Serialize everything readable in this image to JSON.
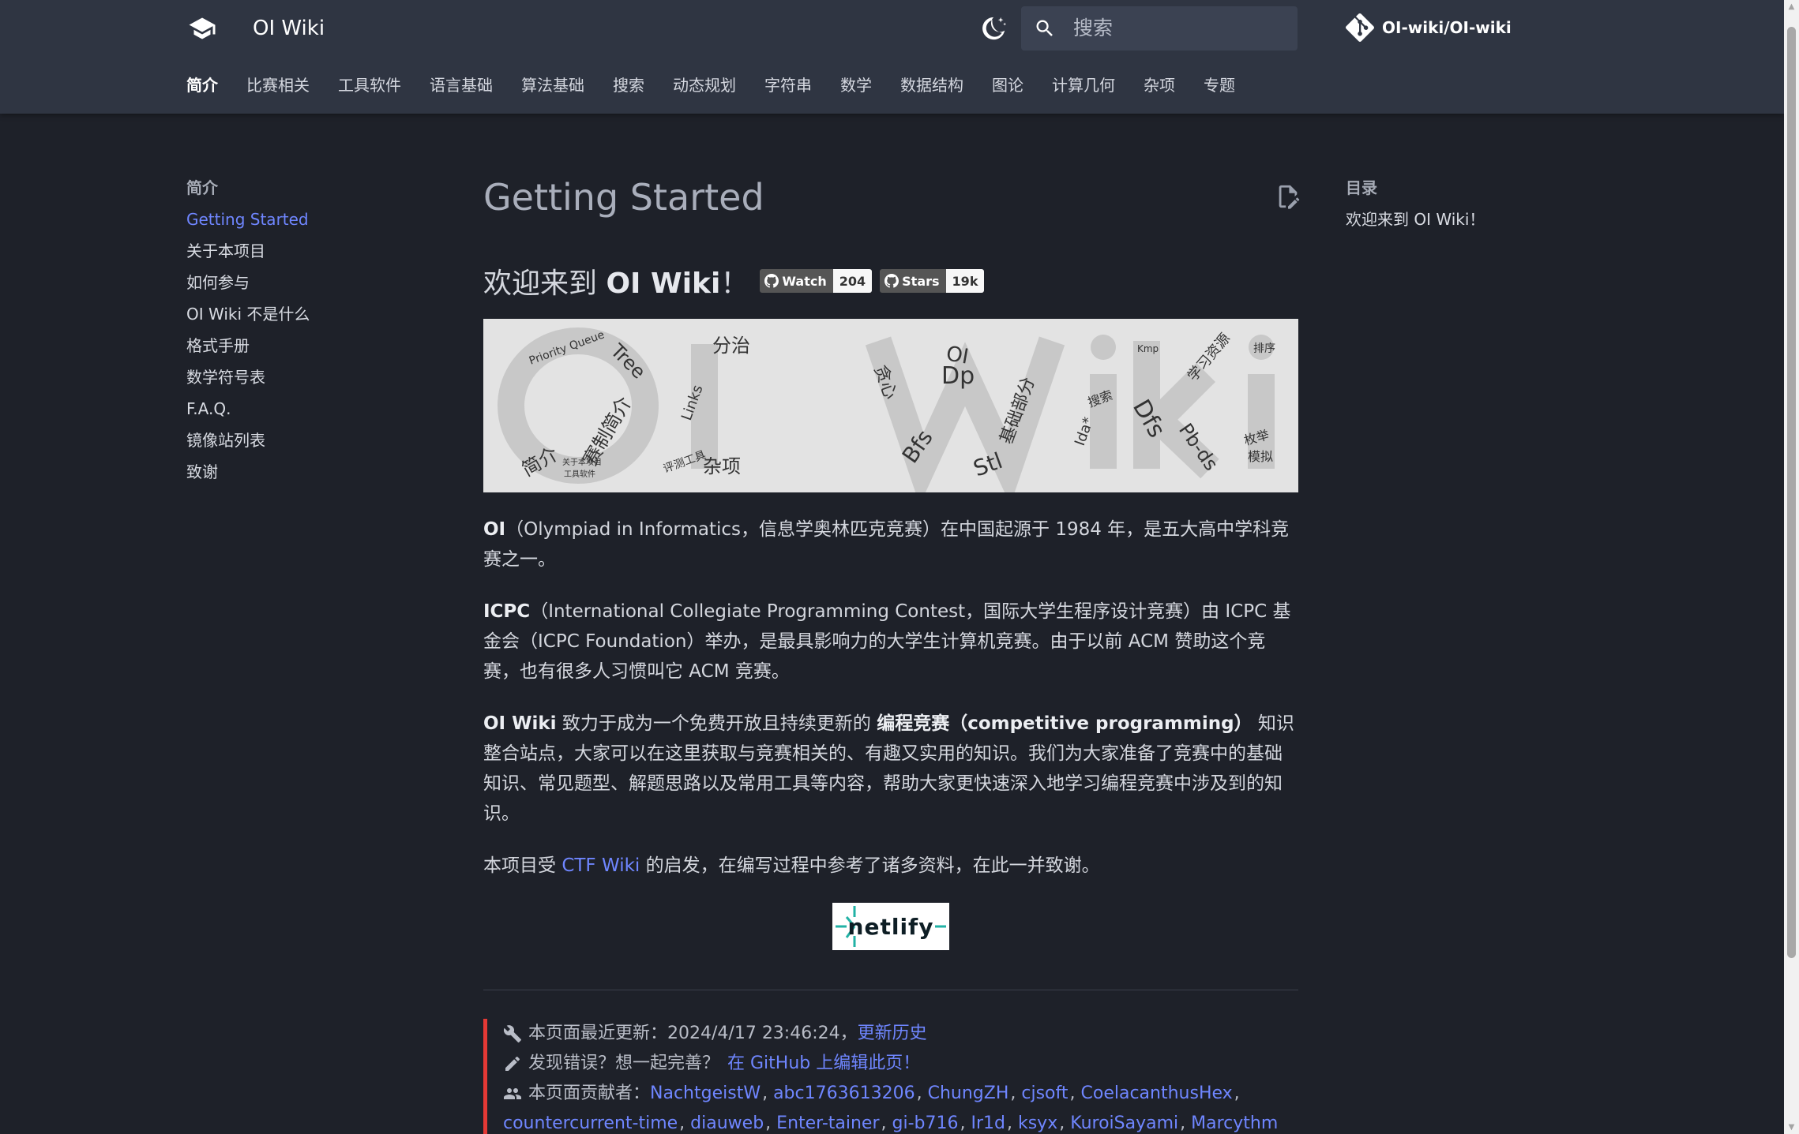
{
  "header": {
    "site_title": "OI Wiki",
    "search_placeholder": "搜索",
    "repo_name": "OI-wiki/OI-wiki",
    "tabs": [
      "简介",
      "比赛相关",
      "工具软件",
      "语言基础",
      "算法基础",
      "搜索",
      "动态规划",
      "字符串",
      "数学",
      "数据结构",
      "图论",
      "计算几何",
      "杂项",
      "专题"
    ]
  },
  "left_nav": {
    "title": "简介",
    "items": [
      "Getting Started",
      "关于本项目",
      "如何参与",
      "OI Wiki 不是什么",
      "格式手册",
      "数学符号表",
      "F.A.Q.",
      "镜像站列表",
      "致谢"
    ]
  },
  "toc": {
    "title": "目录",
    "items": [
      "欢迎来到 OI Wiki！"
    ]
  },
  "main": {
    "page_title": "Getting Started",
    "welcome_prefix": "欢迎来到 ",
    "welcome_bold": "OI Wiki",
    "welcome_suffix": "！",
    "badges": [
      {
        "label": "Watch",
        "count": "204"
      },
      {
        "label": "Stars",
        "count": "19k"
      }
    ],
    "p1_bold": "OI",
    "p1_text": "（Olympiad in Informatics，信息学奥林匹克竞赛）在中国起源于 1984 年，是五大高中学科竞赛之一。",
    "p2_bold": "ICPC",
    "p2_text": "（International Collegiate Programming Contest，国际大学生程序设计竞赛）由 ICPC 基金会（ICPC Foundation）举办，是最具影响力的大学生计算机竞赛。由于以前 ACM 赞助这个竞赛，也有很多人习惯叫它 ACM 竞赛。",
    "p3_bold1": "OI Wiki",
    "p3_text1": " 致力于成为一个免费开放且持续更新的 ",
    "p3_bold2": "编程竞赛（competitive programming）",
    "p3_text2": " 知识整合站点，大家可以在这里获取与竞赛相关的、有趣又实用的知识。我们为大家准备了竞赛中的基础知识、常见题型、解题思路以及常用工具等内容，帮助大家更快速深入地学习编程竞赛中涉及到的知识。",
    "p4_text1": "本项目受 ",
    "p4_link": "CTF Wiki",
    "p4_text2": " 的启发，在编写过程中参考了诸多资料，在此一并致谢。",
    "netlify_label": "netlify"
  },
  "footer": {
    "updated_label": "本页面最近更新：",
    "updated_time": "2024/4/17 23:46:24，",
    "history_link": "更新历史",
    "error_label": "发现错误？想一起完善？",
    "edit_link": "在 GitHub 上编辑此页！",
    "contrib_label": "本页面贡献者：",
    "contributors_line1": [
      "NachtgeistW",
      "abc1763613206",
      "ChungZH",
      "cjsoft",
      "CoelacanthusHex"
    ],
    "contributors_line2": [
      "countercurrent-time",
      "diauweb",
      "Enter-tainer",
      "gi-b716",
      "Ir1d",
      "ksyx",
      "KuroiSayami",
      "Marcythm"
    ]
  },
  "banner_words": [
    "Priority Queue",
    "Tree",
    "分治",
    "简介",
    "赛制简介",
    "杂项",
    "Links",
    "OI",
    "Dp",
    "贪心",
    "Bfs",
    "Stl",
    "基础部分",
    "Dfs",
    "Pb-ds",
    "排序",
    "搜索",
    "Ida*",
    "学习资源",
    "枚举",
    "模拟",
    "Kmp",
    "评测工具",
    "关于本项目",
    "工具软件"
  ],
  "colors": {
    "background": "#1e2129",
    "header": "#2f3542",
    "accent": "#6f86ff",
    "footer_bar": "#e53935"
  }
}
